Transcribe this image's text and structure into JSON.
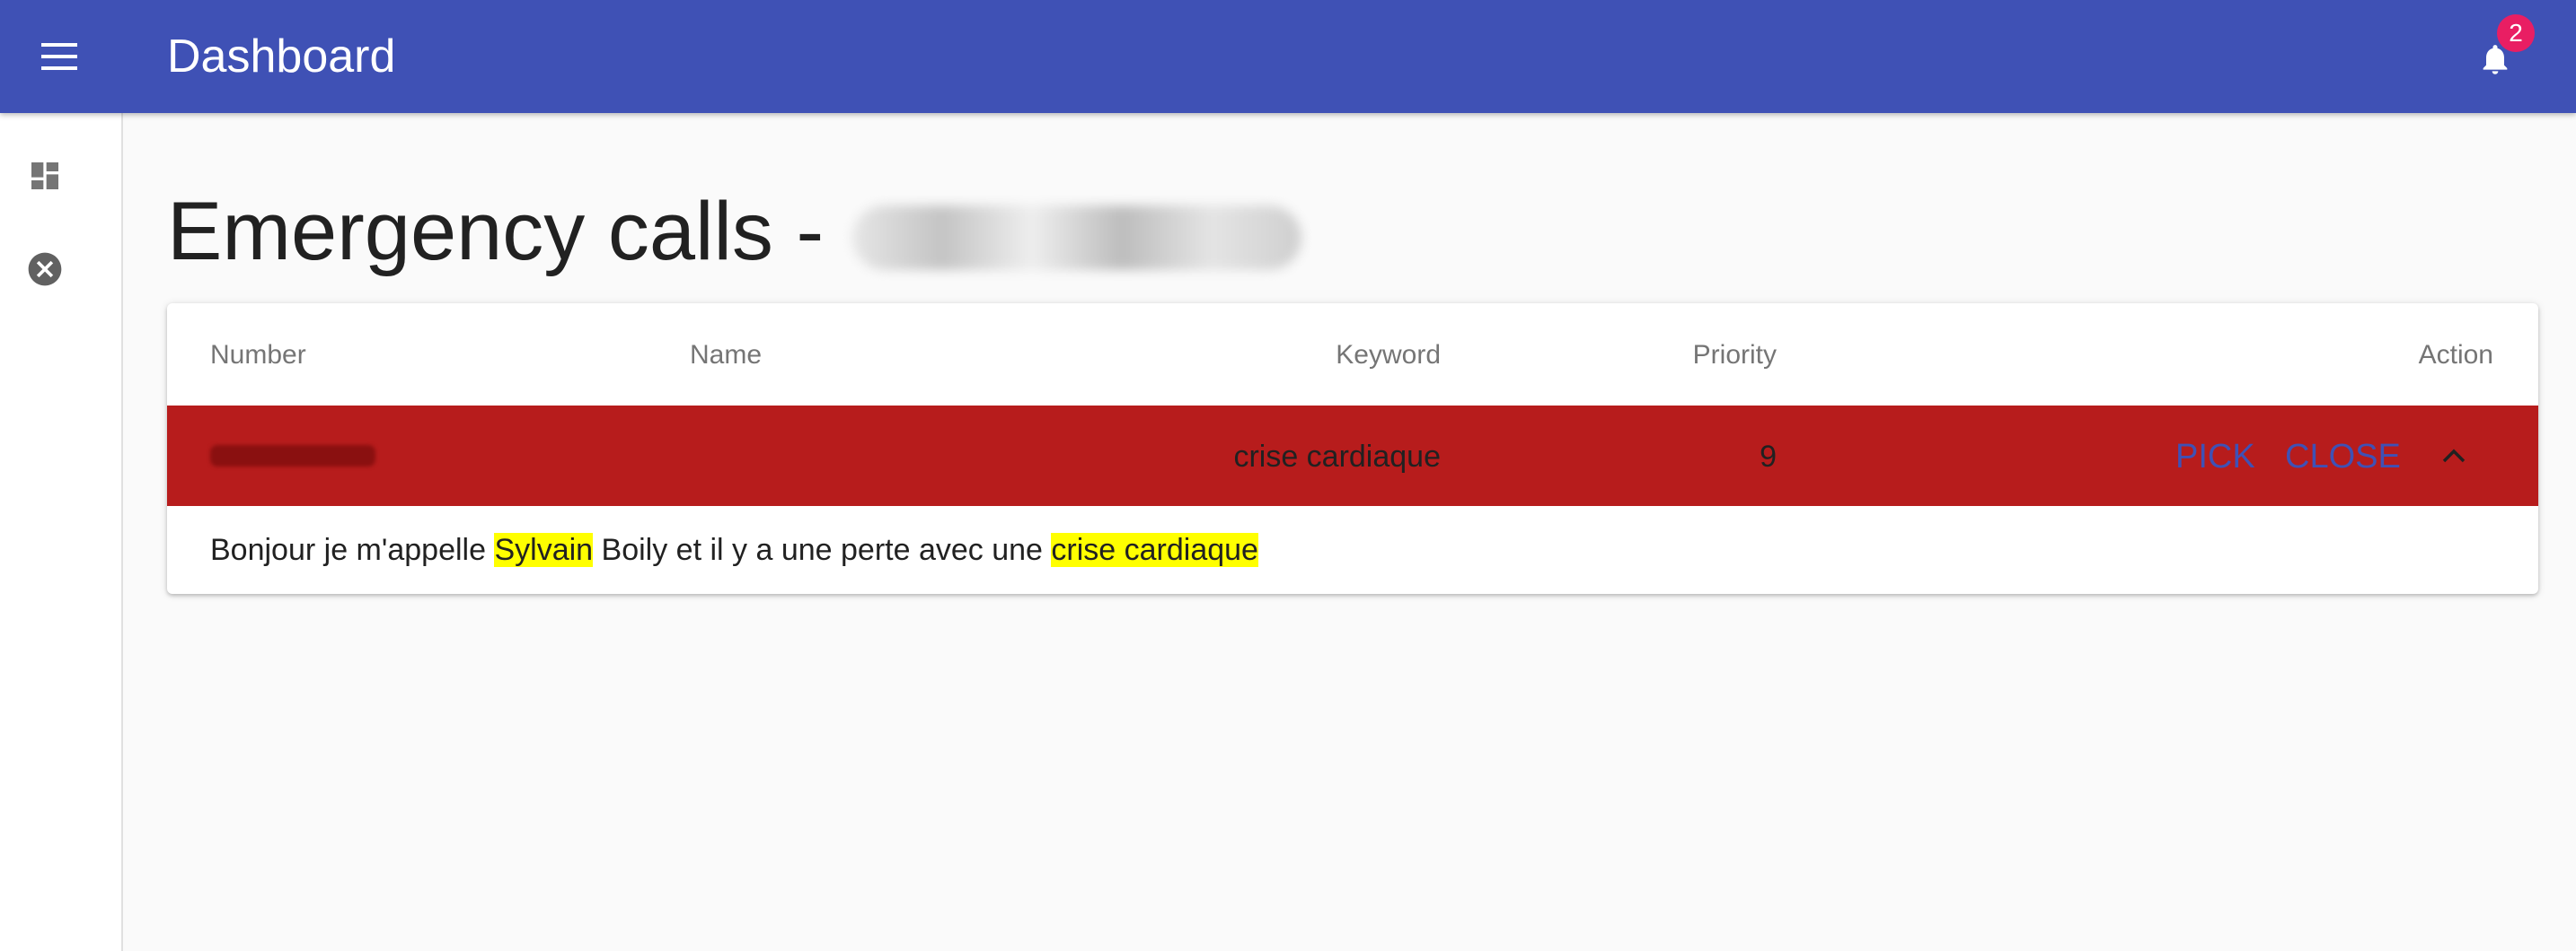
{
  "appbar": {
    "title": "Dashboard",
    "notifications_count": "2",
    "color": "#3f51b5"
  },
  "drawer": {
    "items": [
      {
        "icon": "dashboard-icon"
      },
      {
        "icon": "cancel-circle-icon"
      }
    ]
  },
  "page": {
    "title": "Emergency calls -"
  },
  "table": {
    "headers": {
      "number": "Number",
      "name": "Name",
      "keyword": "Keyword",
      "priority": "Priority",
      "action": "Action"
    },
    "rows": [
      {
        "keyword": "crise cardiaque",
        "priority": "9",
        "pick_label": "PICK",
        "close_label": "CLOSE",
        "row_color": "#b71c1c",
        "details": {
          "segments": [
            {
              "text": "Bonjour je m'appelle ",
              "highlight": false
            },
            {
              "text": "Sylvain",
              "highlight": true
            },
            {
              "text": " Boily et il y a une perte avec une ",
              "highlight": false
            },
            {
              "text": "crise cardiaque",
              "highlight": true
            }
          ]
        }
      }
    ]
  }
}
